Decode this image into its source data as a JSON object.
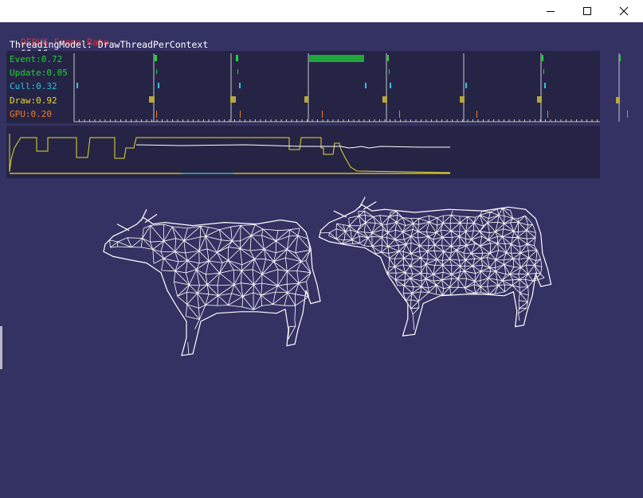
{
  "window": {
    "controls": [
      "minimize",
      "maximize",
      "close"
    ]
  },
  "hud": {
    "frame_rate_label": "DEBUG Frame Rate",
    "frame_rate_value": "60.16",
    "threading_model": "ThreadingModel: DrawThreadPerContext",
    "stats": [
      {
        "label": "Event:0.72",
        "color": "#1fd43a"
      },
      {
        "label": "Update:0.05",
        "color": "#1fd43a"
      },
      {
        "label": "Cull:0.32",
        "color": "#2ec4e6"
      },
      {
        "label": "Draw:0.92",
        "color": "#e6d830"
      },
      {
        "label": "GPU:0.20",
        "color": "#f07a22"
      }
    ]
  },
  "colors": {
    "background": "#343263",
    "panel": "#252445",
    "frame_rate_label": "#e0303a",
    "text": "#ffffff",
    "wireframe": "#ffffff"
  },
  "scene": {
    "icons": [
      "cow-wireframe",
      "cow-wireframe"
    ]
  }
}
